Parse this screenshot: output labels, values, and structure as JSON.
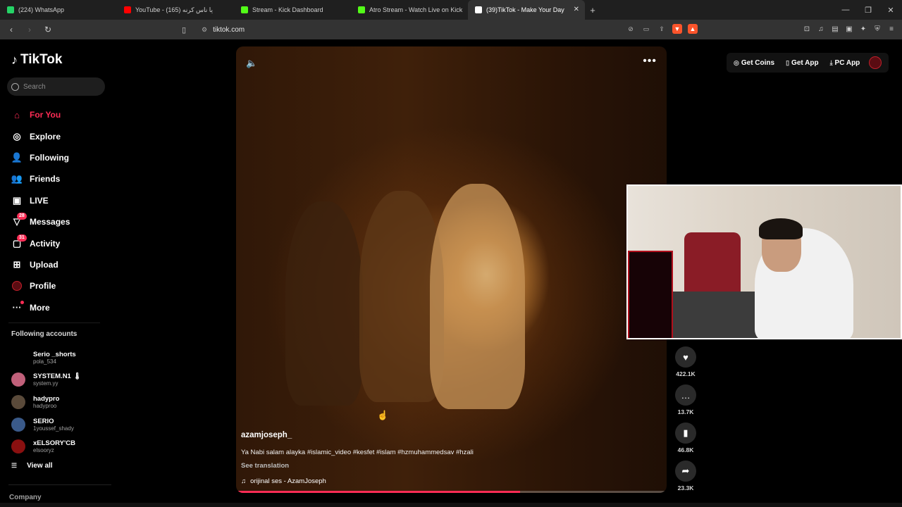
{
  "browser": {
    "tabs": [
      {
        "title": "(224) WhatsApp",
        "color": "#25d366",
        "active": false
      },
      {
        "title": "YouTube - یا ناس کرنه (165)",
        "color": "#ff0000",
        "active": false
      },
      {
        "title": "Stream - Kick Dashboard",
        "color": "#53fc18",
        "active": false
      },
      {
        "title": "Atro Stream - Watch Live on Kick",
        "color": "#53fc18",
        "active": false
      },
      {
        "title": "(39)TikTok - Make Your Day",
        "color": "#ffffff",
        "active": true
      }
    ],
    "new_tab": "+",
    "url": "tiktok.com"
  },
  "sidebar": {
    "logo": "TikTok",
    "search_placeholder": "Search",
    "nav": [
      {
        "label": "For You",
        "icon": "home-icon",
        "glyph": "⌂",
        "active": true
      },
      {
        "label": "Explore",
        "icon": "compass-icon",
        "glyph": "◎",
        "active": false
      },
      {
        "label": "Following",
        "icon": "following-icon",
        "glyph": "👤",
        "active": false
      },
      {
        "label": "Friends",
        "icon": "friends-icon",
        "glyph": "👥",
        "active": false
      },
      {
        "label": "LIVE",
        "icon": "live-icon",
        "glyph": "▣",
        "active": false
      },
      {
        "label": "Messages",
        "icon": "messages-icon",
        "glyph": "▽",
        "badge": "28",
        "active": false
      },
      {
        "label": "Activity",
        "icon": "activity-icon",
        "glyph": "▢",
        "badge": "31",
        "active": false
      },
      {
        "label": "Upload",
        "icon": "upload-icon",
        "glyph": "⊞",
        "active": false
      },
      {
        "label": "Profile",
        "icon": "profile-icon",
        "glyph": "",
        "active": false
      },
      {
        "label": "More",
        "icon": "more-icon",
        "glyph": "···",
        "active": false
      }
    ],
    "following_title": "Following accounts",
    "accounts": [
      {
        "name": "Serio _shorts",
        "user": "pola_534",
        "color": "#000000"
      },
      {
        "name": "SYSTEM.N1 🌡",
        "user": "system.yy",
        "color": "#c0607a"
      },
      {
        "name": "hadypro",
        "user": "hadyproo",
        "color": "#5a4a3a"
      },
      {
        "name": "SERIO",
        "user": "1youssef_shady",
        "color": "#3a5a8a"
      },
      {
        "name": "xELSORY'CB",
        "user": "elsooryz",
        "color": "#8a1010"
      }
    ],
    "view_all": "View all",
    "company": "Company"
  },
  "video": {
    "author": "azamjoseph_",
    "caption": "Ya Nabi salam alayka #islamic_video #kesfet #islam #hzmuhammedsav #hzali",
    "see_translation": "See translation",
    "music": "orijinal ses - AzamJoseph",
    "progress": 0.66
  },
  "topbar": {
    "get_coins": "Get Coins",
    "get_app": "Get App",
    "pc_app": "PC App"
  },
  "actions": [
    {
      "icon": "heart-icon",
      "glyph": "♥",
      "count": "422.1K"
    },
    {
      "icon": "comment-icon",
      "glyph": "…",
      "count": "13.7K"
    },
    {
      "icon": "bookmark-icon",
      "glyph": "▮",
      "count": "46.8K"
    },
    {
      "icon": "share-icon",
      "glyph": "➦",
      "count": "23.3K"
    }
  ]
}
